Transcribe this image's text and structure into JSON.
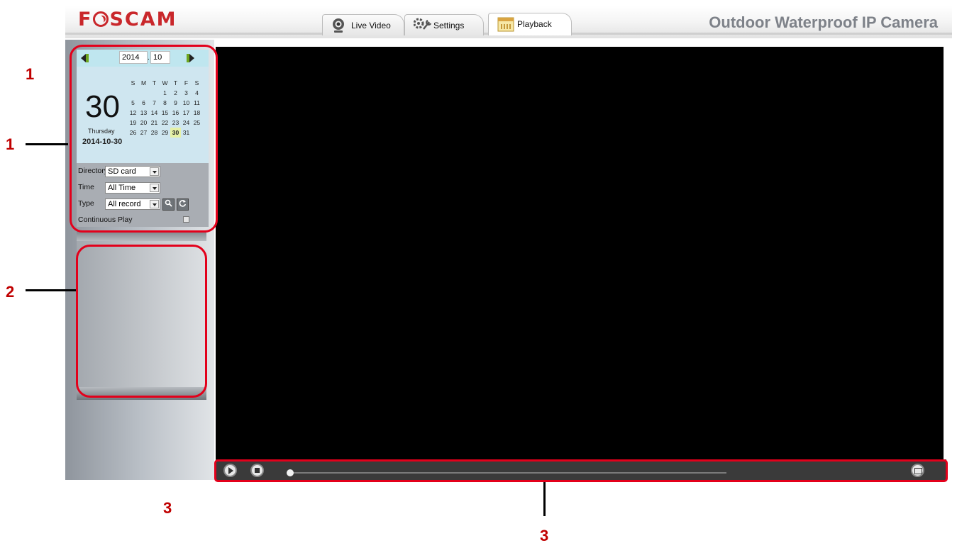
{
  "header": {
    "logo": "FOSCAM",
    "product_title": "Outdoor Waterproof IP Camera",
    "tabs": [
      {
        "label": "Live Video",
        "icon": "webcam-icon"
      },
      {
        "label": "Settings",
        "icon": "gears-icon"
      },
      {
        "label": "Playback",
        "icon": "calendar-icon",
        "active": true
      }
    ]
  },
  "calendar": {
    "year": "2014",
    "month": "10",
    "separator": ".",
    "weekday_headers": [
      "S",
      "M",
      "T",
      "W",
      "T",
      "F",
      "S"
    ],
    "big_day": "30",
    "weekday_name": "Thursday",
    "full_date": "2014-10-30",
    "weeks": [
      [
        "",
        "",
        "",
        "1",
        "2",
        "3",
        "4"
      ],
      [
        "5",
        "6",
        "7",
        "8",
        "9",
        "10",
        "11"
      ],
      [
        "12",
        "13",
        "14",
        "15",
        "16",
        "17",
        "18"
      ],
      [
        "19",
        "20",
        "21",
        "22",
        "23",
        "24",
        "25"
      ],
      [
        "26",
        "27",
        "28",
        "29",
        "30",
        "31",
        ""
      ]
    ],
    "selected_day": "30"
  },
  "filters": {
    "directory_label": "Directory",
    "directory_value": "SD card",
    "time_label": "Time",
    "time_value": "All Time",
    "type_label": "Type",
    "type_value": "All record",
    "continuous_label": "Continuous Play",
    "continuous_checked": false
  },
  "player": {
    "progress": 0.0
  },
  "annotations": {
    "callout_1": "1",
    "callout_1b": "1",
    "callout_2": "2",
    "callout_3": "3",
    "callout_3b": "3",
    "color": "#e3001b"
  }
}
